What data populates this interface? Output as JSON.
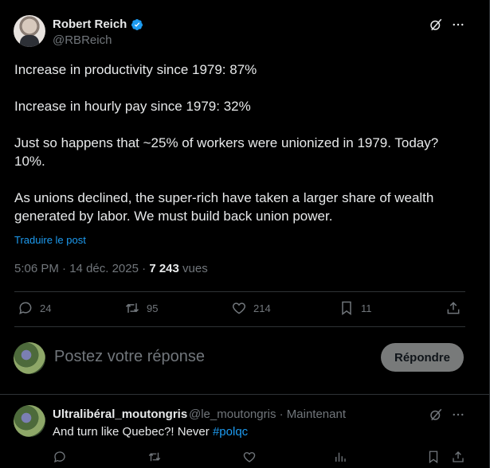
{
  "post": {
    "author_name": "Robert Reich",
    "author_handle": "@RBReich",
    "paragraphs": [
      "Increase in productivity since 1979: 87%",
      "Increase in hourly pay since 1979: 32%",
      "Just so happens that ~25% of workers were unionized in 1979. Today? 10%.",
      "As unions declined, the super-rich have taken a larger share of wealth generated by labor. We must build back union power."
    ],
    "translate_label": "Traduire le post",
    "time": "5:06 PM",
    "date": "14 déc. 2025",
    "separator": " · ",
    "views_count": "7 243",
    "views_label": " vues"
  },
  "actions": {
    "replies": "24",
    "reposts": "95",
    "likes": "214",
    "bookmarks": "11"
  },
  "reply_box": {
    "placeholder": "Postez votre réponse",
    "button_label": "Répondre"
  },
  "reply": {
    "author_name": "Ultralibéral_moutongris",
    "handle_and_time": "@le_moutongris · Maintenant",
    "text": "And turn like Quebec?! Never ",
    "hashtag": "#polqc"
  },
  "colors": {
    "background": "#000000",
    "text": "#e7e9ea",
    "muted": "#71767b",
    "accent": "#1d9bf0",
    "border": "#2f3336"
  },
  "icons": [
    "verified-badge-icon",
    "grok-icon",
    "more-icon",
    "reply-icon",
    "repost-icon",
    "like-icon",
    "bookmark-icon",
    "share-icon",
    "views-icon"
  ]
}
